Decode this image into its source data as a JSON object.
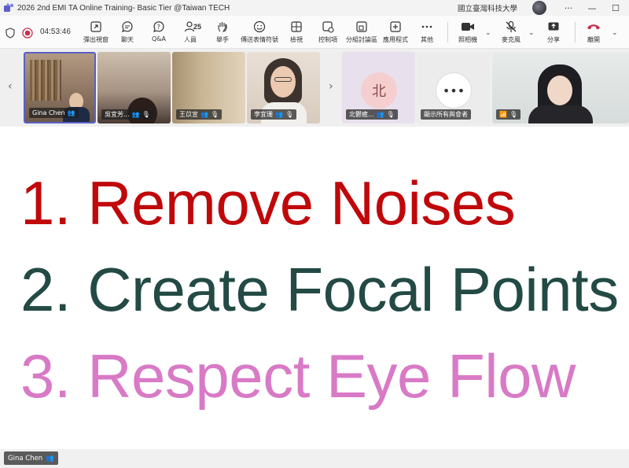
{
  "window": {
    "title": "2026 2nd EMI TA Online Training- Basic Tier @Taiwan TECH",
    "org_name": "國立臺灣科技大學"
  },
  "meeting": {
    "timer": "04:53:46",
    "people_count": "25"
  },
  "toolbar": {
    "items": [
      {
        "label": "彈出視窗",
        "icon": "pop-out-icon"
      },
      {
        "label": "聊天",
        "icon": "chat-icon"
      },
      {
        "label": "Q&A",
        "icon": "qa-icon"
      },
      {
        "label": "人員",
        "icon": "people-icon"
      },
      {
        "label": "舉手",
        "icon": "raise-hand-icon"
      },
      {
        "label": "傳送表情符號",
        "icon": "emoji-icon"
      },
      {
        "label": "檢視",
        "icon": "view-icon"
      },
      {
        "label": "控制項",
        "icon": "controls-icon"
      },
      {
        "label": "分組討論區",
        "icon": "breakout-icon"
      },
      {
        "label": "應用程式",
        "icon": "apps-icon"
      },
      {
        "label": "其他",
        "icon": "more-icon"
      }
    ],
    "camera_label": "照相機",
    "mic_label": "麥克風",
    "share_label": "分享",
    "leave_label": "離開"
  },
  "participants": [
    {
      "name": "Gina Chen"
    },
    {
      "name": "吳宜芳..."
    },
    {
      "name": "王苡宣"
    },
    {
      "name": "李宜珊"
    },
    {
      "name": "北鬱癒...",
      "initial": "北"
    },
    {
      "name": "顯示所有與會者"
    },
    {
      "name": ""
    }
  ],
  "slide": {
    "points": [
      {
        "text": "1. Remove Noises",
        "color": "#c0080a"
      },
      {
        "text": "2. Create Focal Points",
        "color": "#234a45"
      },
      {
        "text": "3. Respect Eye Flow",
        "color": "#d87ac6"
      }
    ]
  },
  "presenter": {
    "name": "Gina Chen"
  },
  "colors": {
    "record": "#c4314b",
    "leave": "#c4314b",
    "tile_border": "#5b5fc7"
  }
}
